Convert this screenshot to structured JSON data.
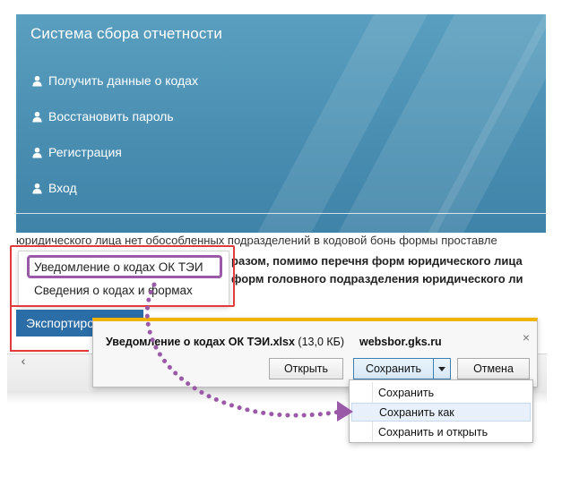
{
  "header": {
    "title": "Система сбора отчетности",
    "nav": [
      {
        "label": "Получить данные о кодах",
        "icon": "user-icon"
      },
      {
        "label": "Восстановить пароль",
        "icon": "user-icon"
      },
      {
        "label": "Регистрация",
        "icon": "user-icon"
      },
      {
        "label": "Вход",
        "icon": "user-icon"
      }
    ]
  },
  "page": {
    "line1": "юридического лица нет обособленных подразделений в кодовой бонь формы проставле",
    "line2": "разом, помимо перечня форм юридического лица",
    "line3": "форм головного подразделения юридического ли"
  },
  "export_menu": {
    "items": [
      "Уведомление о кодах ОК ТЭИ",
      "Сведения о кодах и формах"
    ],
    "button_label": "Экспортировать"
  },
  "download_bar": {
    "file_name": "Уведомление о кодах ОК ТЭИ.xlsx",
    "file_size": "(13,0 КБ)",
    "site": "websbor.gks.ru",
    "open_label": "Открыть",
    "save_label": "Сохранить",
    "cancel_label": "Отмена",
    "close_symbol": "×"
  },
  "save_menu": {
    "items": [
      "Сохранить",
      "Сохранить как",
      "Сохранить и открыть"
    ],
    "highlighted_index": 1
  },
  "colors": {
    "header_blue": "#4a8fb2",
    "export_button": "#2b6da6",
    "annotation_red": "#e23b3b",
    "annotation_purple": "#9b5aa8",
    "download_bar_accent": "#f0b400"
  },
  "icons": {
    "scroll_left": "‹"
  }
}
